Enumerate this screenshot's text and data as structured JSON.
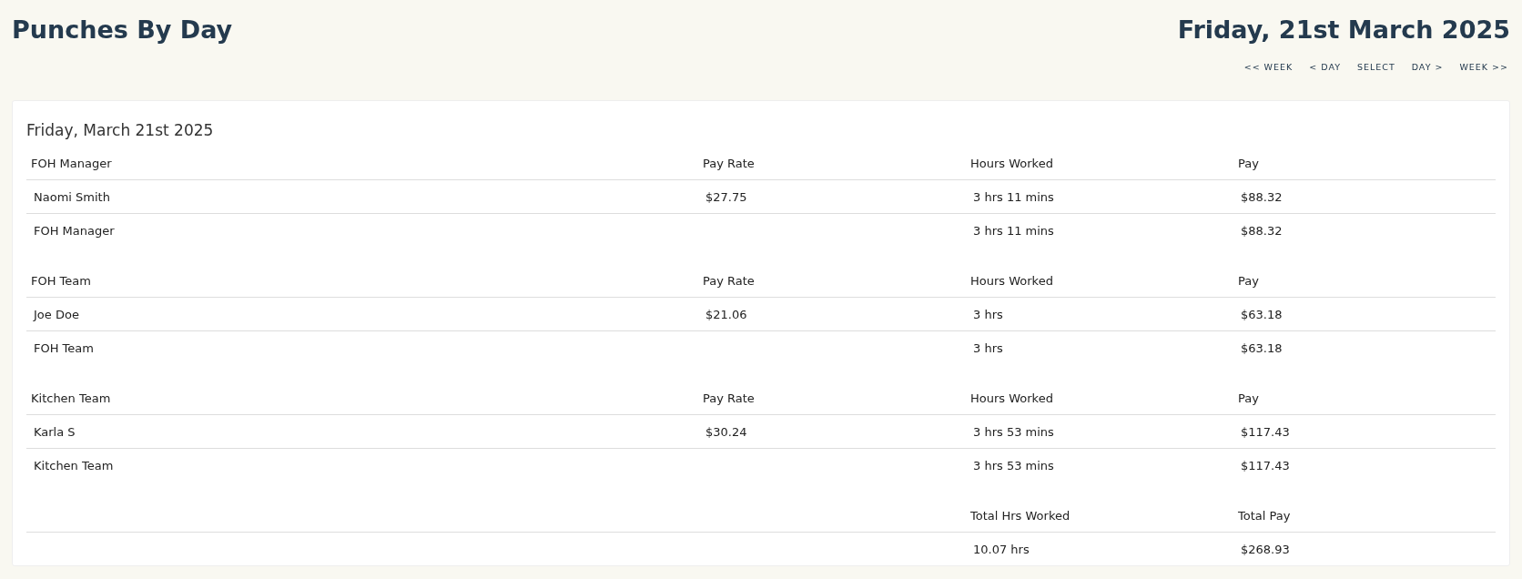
{
  "page_title": "Punches By Day",
  "current_date": "Friday, 21st March 2025",
  "nav_links": [
    "<< WEEK",
    "< DAY",
    "SELECT",
    "DAY >",
    "WEEK >>"
  ],
  "report": {
    "date_heading": "Friday, March 21st 2025",
    "groups": [
      {
        "name": "FOH Manager",
        "columns": [
          "Pay Rate",
          "Hours Worked",
          "Pay"
        ],
        "rows": [
          {
            "name": "Naomi Smith",
            "pay_rate": "$27.75",
            "hours": "3 hrs 11 mins",
            "pay": "$88.32"
          }
        ],
        "subtotal": {
          "name": "FOH Manager",
          "hours": "3 hrs 11 mins",
          "pay": "$88.32"
        }
      },
      {
        "name": "FOH Team",
        "columns": [
          "Pay Rate",
          "Hours Worked",
          "Pay"
        ],
        "rows": [
          {
            "name": "Joe Doe",
            "pay_rate": "$21.06",
            "hours": "3 hrs",
            "pay": "$63.18"
          }
        ],
        "subtotal": {
          "name": "FOH Team",
          "hours": "3 hrs",
          "pay": "$63.18"
        }
      },
      {
        "name": "Kitchen Team",
        "columns": [
          "Pay Rate",
          "Hours Worked",
          "Pay"
        ],
        "rows": [
          {
            "name": "Karla S",
            "pay_rate": "$30.24",
            "hours": "3 hrs 53 mins",
            "pay": "$117.43"
          }
        ],
        "subtotal": {
          "name": "Kitchen Team",
          "hours": "3 hrs 53 mins",
          "pay": "$117.43"
        }
      }
    ],
    "totals": {
      "columns": [
        "Total Hrs Worked",
        "Total Pay"
      ],
      "hours": "10.07 hrs",
      "pay": "$268.93"
    }
  }
}
